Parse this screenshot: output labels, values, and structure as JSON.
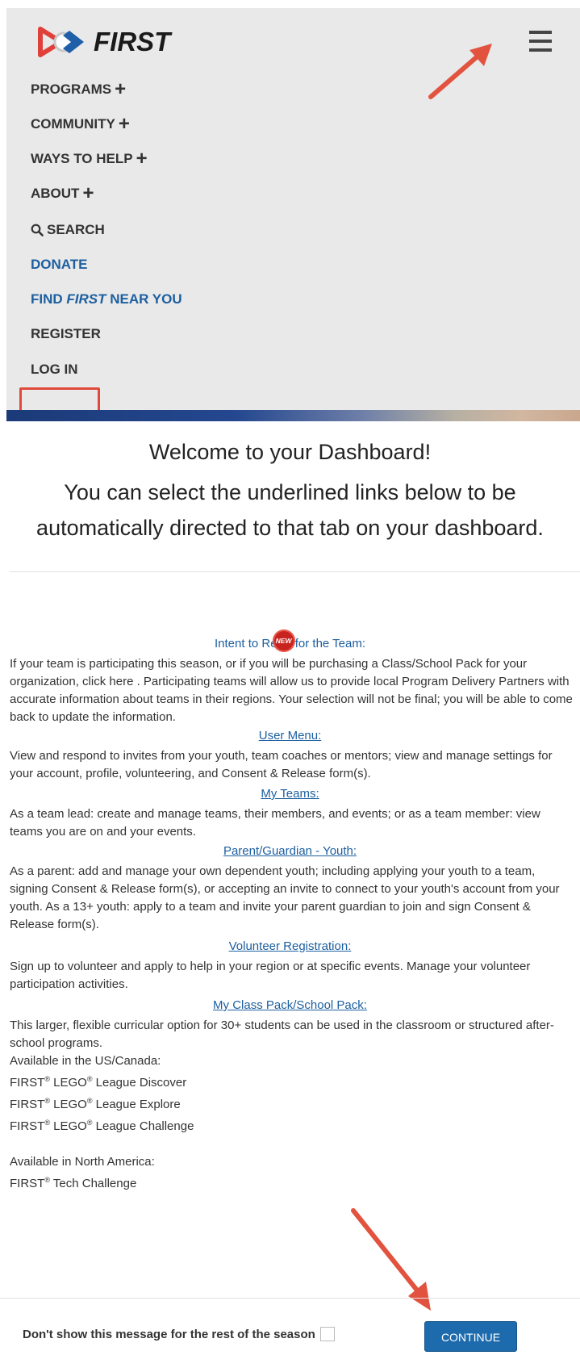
{
  "nav": {
    "logo_text": "FIRST",
    "items": [
      {
        "label": "PROGRAMS",
        "plus": "+"
      },
      {
        "label": "COMMUNITY",
        "plus": "+"
      },
      {
        "label": "WAYS TO HELP",
        "plus": "+"
      },
      {
        "label": "ABOUT",
        "plus": "+"
      },
      {
        "label": "SEARCH"
      },
      {
        "label": "DONATE"
      },
      {
        "label_pre": "FIND ",
        "label_em": "FIRST",
        "label_post": " NEAR YOU"
      },
      {
        "label": "REGISTER"
      },
      {
        "label": "LOG IN"
      }
    ]
  },
  "dashboard": {
    "title": "Welcome to your Dashboard!",
    "subtitle": "You can select the underlined links below to be automatically directed to that tab on your dashboard.",
    "sections": [
      {
        "heading_pre": "Intent to Re",
        "badge": "NEW",
        "heading_post": " for the Team:",
        "body": "If your team is participating this season, or if you will be purchasing a Class/School Pack for your organization, click here . Participating teams will allow us to provide local Program Delivery Partners with accurate information about teams in their regions. Your selection will not be final; you will be able to come back to update the information."
      },
      {
        "heading": "User Menu:",
        "body": "View and respond to invites from your youth, team coaches or mentors; view and manage settings for your account, profile, volunteering, and Consent & Release form(s)."
      },
      {
        "heading": "My Teams:",
        "body": "As a team lead: create and manage teams, their members, and events; or as a team member: view teams you are on and your events."
      },
      {
        "heading": "Parent/Guardian - Youth:",
        "body": "As a parent: add and manage your own dependent youth; including applying your youth to a team, signing Consent & Release form(s), or accepting an invite to connect to your youth's account from your youth. As a 13+ youth: apply to a team and invite your parent guardian to join and sign Consent & Release form(s)."
      },
      {
        "heading": "Volunteer Registration:",
        "body": "Sign up to volunteer and apply to help in your region or at specific events. Manage your volunteer participation activities."
      },
      {
        "heading": "My Class Pack/School Pack:",
        "body": "This larger, flexible curricular option for 30+ students can be used in the classroom or structured after-school programs.",
        "us_heading": "Available in the US/Canada:",
        "us_programs": [
          "League Discover",
          "League Explore",
          "League Challenge"
        ],
        "na_heading": "Available in North America:",
        "na_programs": [
          "Tech Challenge"
        ],
        "brand_first": "FIRST",
        "brand_lego": "LEGO",
        "reg_mark": "®"
      }
    ]
  },
  "footer": {
    "dont_show_label": "Don't show this message for the rest of the season",
    "continue_label": "CONTINUE"
  },
  "colors": {
    "link_blue": "#1c5fa0",
    "continue_button": "#1d6aad",
    "highlight_red": "#e04a3b",
    "arrow_red": "#e2533f",
    "nav_background": "#e9e9e9"
  }
}
